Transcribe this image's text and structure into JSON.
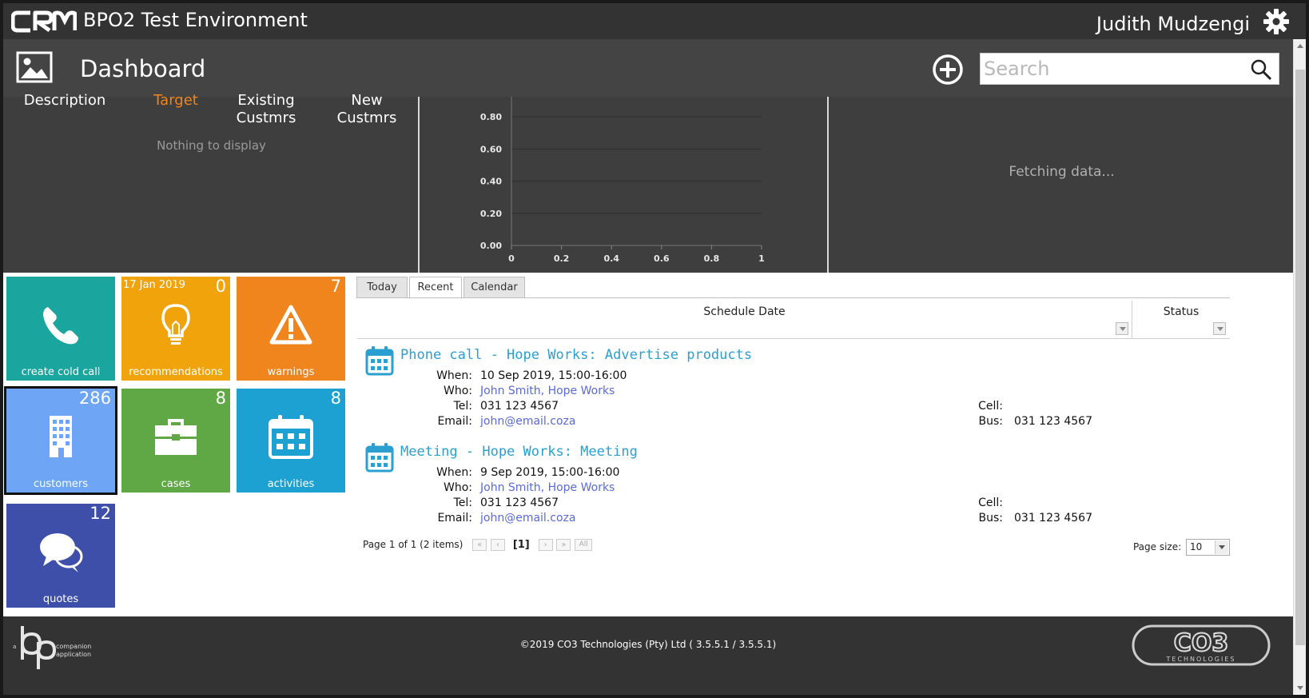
{
  "app": {
    "logo_text": "CRM",
    "environment_title": "BPO2 Test Environment",
    "user_name": "Judith Mudzengi",
    "page_title": "Dashboard",
    "search_placeholder": "Search"
  },
  "widgets": {
    "targets": {
      "columns": [
        "Description",
        "Target",
        "Existing\nCustmrs",
        "New\nCustmrs"
      ],
      "empty_text": "Nothing to display"
    },
    "right_panel": {
      "status_text": "Fetching data..."
    }
  },
  "chart_data": {
    "type": "line",
    "title": "",
    "xlabel": "",
    "ylabel": "",
    "x_ticks": [
      "0",
      "0.2",
      "0.4",
      "0.6",
      "0.8",
      "1"
    ],
    "y_ticks": [
      "0.00",
      "0.20",
      "0.40",
      "0.60",
      "0.80"
    ],
    "xlim": [
      0,
      1
    ],
    "ylim": [
      0,
      0.8
    ],
    "grid": true,
    "series": []
  },
  "tiles": [
    {
      "id": "create-cold-call",
      "label": "create cold call",
      "count": "",
      "date": "",
      "color": "#1aa59e",
      "icon": "phone-icon"
    },
    {
      "id": "recommendations",
      "label": "recommendations",
      "count": "0",
      "date": "17 Jan 2019",
      "color": "#f0a30a",
      "icon": "lightbulb-icon"
    },
    {
      "id": "warnings",
      "label": "warnings",
      "count": "7",
      "date": "",
      "color": "#f0851d",
      "icon": "warning-icon"
    },
    {
      "id": "customers",
      "label": "customers",
      "count": "286",
      "date": "",
      "color": "#6ea6f5",
      "icon": "building-icon"
    },
    {
      "id": "cases",
      "label": "cases",
      "count": "8",
      "date": "",
      "color": "#5fa845",
      "icon": "briefcase-icon"
    },
    {
      "id": "activities",
      "label": "activities",
      "count": "8",
      "date": "",
      "color": "#1ca1d2",
      "icon": "calendar-icon"
    },
    {
      "id": "quotes",
      "label": "quotes",
      "count": "12",
      "date": "",
      "color": "#3d4fa8",
      "icon": "chat-bubbles-icon"
    }
  ],
  "tabs": [
    {
      "label": "Today",
      "active": false
    },
    {
      "label": "Recent",
      "active": true
    },
    {
      "label": "Calendar",
      "active": false
    }
  ],
  "grid": {
    "columns": [
      "Schedule Date",
      "Status"
    ],
    "labels": {
      "when": "When:",
      "who": "Who:",
      "tel": "Tel:",
      "email": "Email:",
      "cell": "Cell:",
      "bus": "Bus:"
    },
    "activities": [
      {
        "title": "Phone call - Hope Works: Advertise products",
        "when": "10 Sep 2019, 15:00-16:00",
        "who": "John Smith, Hope Works",
        "tel": "031 123 4567",
        "email": "john@email.coza",
        "cell": "",
        "bus": "031 123 4567"
      },
      {
        "title": "Meeting - Hope Works: Meeting",
        "when": "9 Sep 2019, 15:00-16:00",
        "who": "John Smith, Hope Works",
        "tel": "031 123 4567",
        "email": "john@email.coza",
        "cell": "",
        "bus": "031 123 4567"
      }
    ],
    "pager": {
      "info": "Page 1 of 1 (2 items)",
      "current": "[1]",
      "all_label": "All",
      "page_size_label": "Page size:",
      "page_size": "10"
    }
  },
  "footer": {
    "copyright": "©2019 CO3 Technologies (Pty) Ltd ( 3.5.5.1 / 3.5.5.1)",
    "bp_logo_text": "companion application",
    "co3_logo_text": "CO3 TECHNOLOGIES"
  }
}
